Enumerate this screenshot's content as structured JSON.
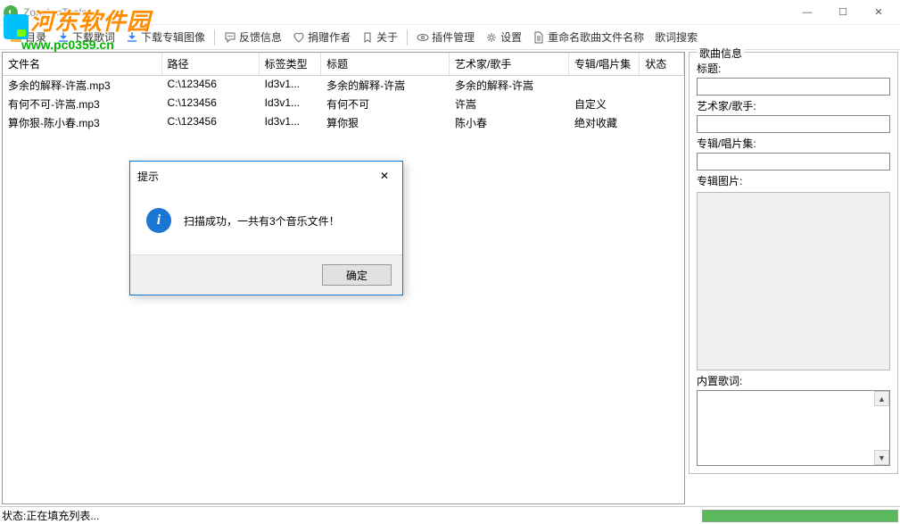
{
  "window": {
    "title": "ZonyLrcTools",
    "min": "—",
    "max": "☐",
    "close": "✕"
  },
  "watermark": {
    "text": "河东软件园",
    "url": "www.pc0359.cn"
  },
  "toolbar": {
    "dir": "目录",
    "dl_lyrics": "下载歌词",
    "dl_album": "下载专辑图像",
    "feedback": "反馈信息",
    "donate": "捐赠作者",
    "about": "关于",
    "plugins": "插件管理",
    "settings": "设置",
    "rename": "重命名歌曲文件名称",
    "search": "歌词搜索"
  },
  "columns": {
    "name": "文件名",
    "path": "路径",
    "tag": "标签类型",
    "title": "标题",
    "artist": "艺术家/歌手",
    "album": "专辑/唱片集",
    "status": "状态"
  },
  "rows": [
    {
      "name": "多余的解释-许嵩.mp3",
      "path": "C:\\123456",
      "tag": "Id3v1...",
      "title": "多余的解释-许嵩",
      "artist": "多余的解释-许嵩",
      "album": ""
    },
    {
      "name": "有何不可-许嵩.mp3",
      "path": "C:\\123456",
      "tag": "Id3v1...",
      "title": "有何不可",
      "artist": "许嵩",
      "album": "自定义"
    },
    {
      "name": "算你狠-陈小春.mp3",
      "path": "C:\\123456",
      "tag": "Id3v1...",
      "title": "算你狠",
      "artist": "陈小春",
      "album": "绝对收藏"
    }
  ],
  "side": {
    "group_title": "歌曲信息",
    "title_label": "标题:",
    "artist_label": "艺术家/歌手:",
    "album_label": "专辑/唱片集:",
    "art_label": "专辑图片:",
    "lyrics_label": "内置歌词:"
  },
  "dialog": {
    "title": "提示",
    "message": "扫描成功，一共有3个音乐文件！",
    "ok": "确定"
  },
  "status": {
    "text": "状态:正在填充列表..."
  }
}
